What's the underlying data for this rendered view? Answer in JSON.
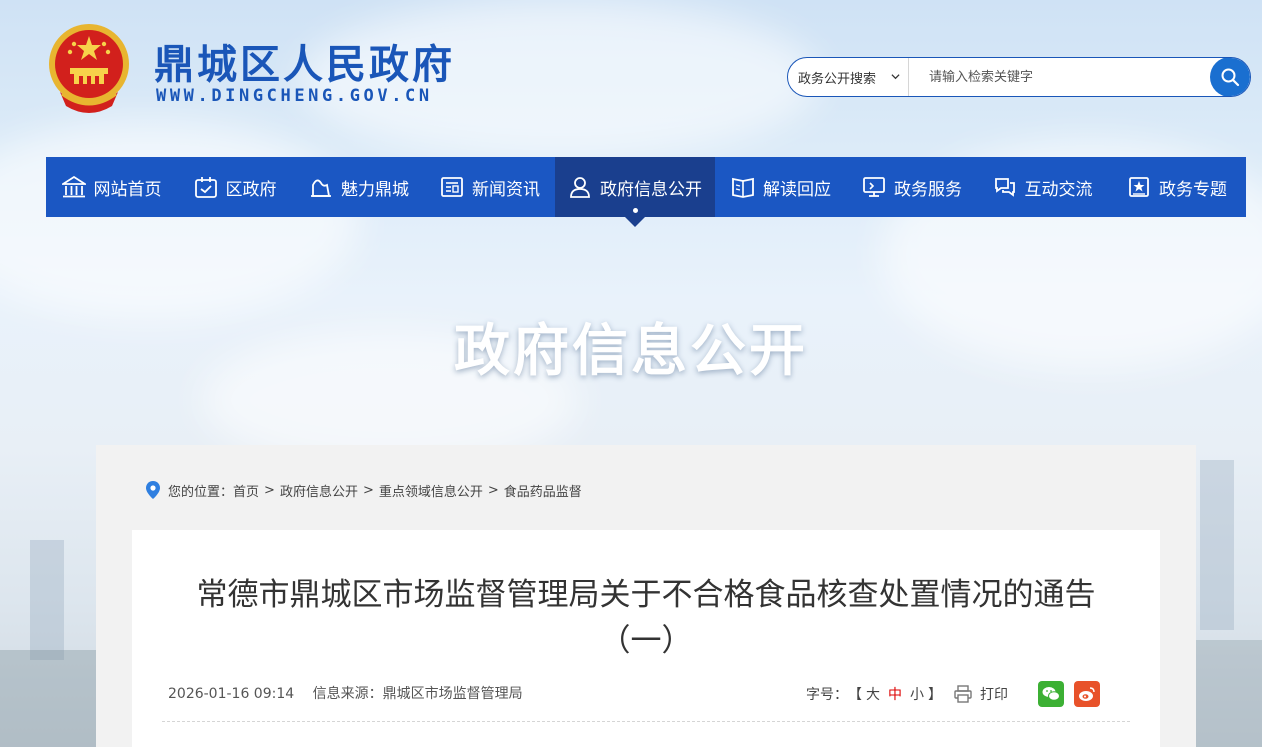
{
  "header": {
    "site_title": "鼎城区人民政府",
    "site_domain": "WWW.DINGCHENG.GOV.CN"
  },
  "search": {
    "scope": "政务公开搜索",
    "placeholder": "请输入检索关键字"
  },
  "nav": {
    "items": [
      {
        "label": "网站首页",
        "icon": "home-icon"
      },
      {
        "label": "区政府",
        "icon": "government-icon"
      },
      {
        "label": "魅力鼎城",
        "icon": "scenery-icon"
      },
      {
        "label": "新闻资讯",
        "icon": "news-icon"
      },
      {
        "label": "政府信息公开",
        "icon": "user-info-icon",
        "active": true
      },
      {
        "label": "解读回应",
        "icon": "book-icon"
      },
      {
        "label": "政务服务",
        "icon": "service-icon"
      },
      {
        "label": "互动交流",
        "icon": "chat-icon"
      },
      {
        "label": "政务专题",
        "icon": "topic-icon"
      }
    ]
  },
  "banner": {
    "title": "政府信息公开"
  },
  "breadcrumb": {
    "prefix": "您的位置：",
    "items": [
      "首页",
      "政府信息公开",
      "重点领域信息公开",
      "食品药品监督"
    ],
    "separator": ">"
  },
  "article": {
    "title_line1": "常德市鼎城区市场监督管理局关于不合格食品核查处置情况的通告",
    "title_line2": "（一）",
    "date": "2026-01-16 09:14",
    "source": "信息来源：鼎城区市场监督管理局",
    "font_size_label": "字号：",
    "bracket_open": "【",
    "bracket_close": "】",
    "font_sizes": [
      "大",
      "中",
      "小"
    ],
    "print_label": "打印"
  },
  "colors": {
    "brand_blue": "#1b57c3",
    "nav_active": "#1a3f8e",
    "wechat_green": "#3cb034",
    "weibo_orange": "#e8522a"
  }
}
